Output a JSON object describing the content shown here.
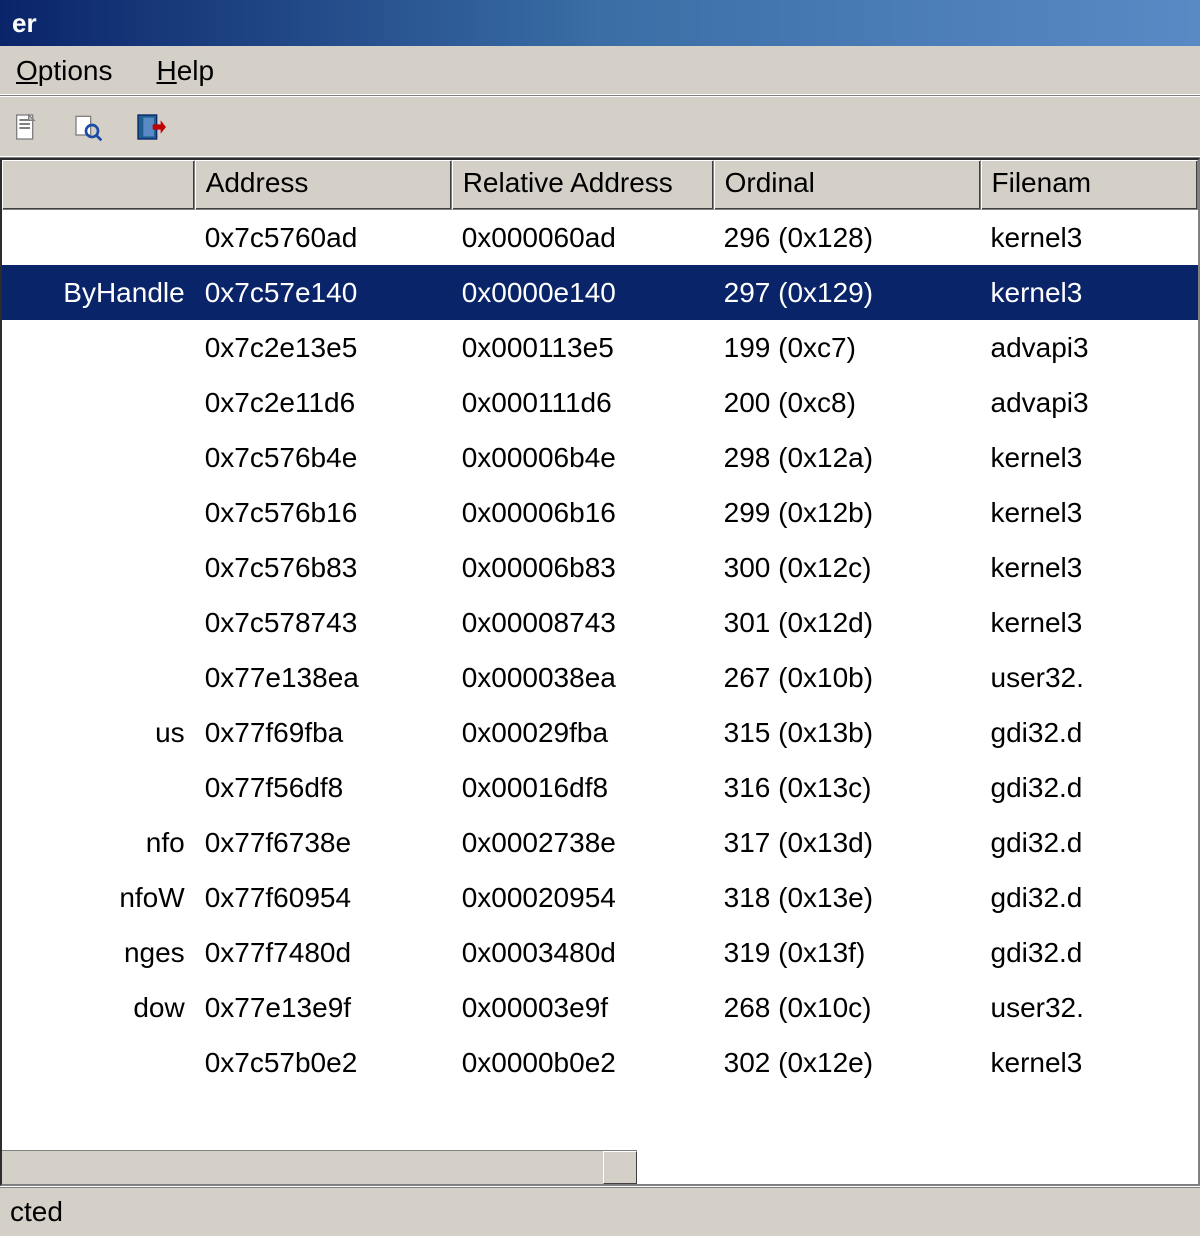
{
  "window": {
    "title": "er"
  },
  "menu": {
    "options": "Options",
    "help": "Help"
  },
  "toolbar": {
    "icons": [
      "document-icon",
      "find-icon",
      "exit-icon"
    ]
  },
  "columns": [
    "",
    "Address",
    "Relative Address",
    "Ordinal",
    "Filenam"
  ],
  "selected_index": 1,
  "rows": [
    {
      "name": "",
      "address": "0x7c5760ad",
      "rel": "0x000060ad",
      "ordinal": "296 (0x128)",
      "file": "kernel3"
    },
    {
      "name": "ByHandle",
      "address": "0x7c57e140",
      "rel": "0x0000e140",
      "ordinal": "297 (0x129)",
      "file": "kernel3"
    },
    {
      "name": "",
      "address": "0x7c2e13e5",
      "rel": "0x000113e5",
      "ordinal": "199 (0xc7)",
      "file": "advapi3"
    },
    {
      "name": "",
      "address": "0x7c2e11d6",
      "rel": "0x000111d6",
      "ordinal": "200 (0xc8)",
      "file": "advapi3"
    },
    {
      "name": "",
      "address": "0x7c576b4e",
      "rel": "0x00006b4e",
      "ordinal": "298 (0x12a)",
      "file": "kernel3"
    },
    {
      "name": "",
      "address": "0x7c576b16",
      "rel": "0x00006b16",
      "ordinal": "299 (0x12b)",
      "file": "kernel3"
    },
    {
      "name": "",
      "address": "0x7c576b83",
      "rel": "0x00006b83",
      "ordinal": "300 (0x12c)",
      "file": "kernel3"
    },
    {
      "name": "",
      "address": "0x7c578743",
      "rel": "0x00008743",
      "ordinal": "301 (0x12d)",
      "file": "kernel3"
    },
    {
      "name": "",
      "address": "0x77e138ea",
      "rel": "0x000038ea",
      "ordinal": "267 (0x10b)",
      "file": "user32."
    },
    {
      "name": "us",
      "address": "0x77f69fba",
      "rel": "0x00029fba",
      "ordinal": "315 (0x13b)",
      "file": "gdi32.d"
    },
    {
      "name": "",
      "address": "0x77f56df8",
      "rel": "0x00016df8",
      "ordinal": "316 (0x13c)",
      "file": "gdi32.d"
    },
    {
      "name": "nfo",
      "address": "0x77f6738e",
      "rel": "0x0002738e",
      "ordinal": "317 (0x13d)",
      "file": "gdi32.d"
    },
    {
      "name": "nfoW",
      "address": "0x77f60954",
      "rel": "0x00020954",
      "ordinal": "318 (0x13e)",
      "file": "gdi32.d"
    },
    {
      "name": "nges",
      "address": "0x77f7480d",
      "rel": "0x0003480d",
      "ordinal": "319 (0x13f)",
      "file": "gdi32.d"
    },
    {
      "name": "dow",
      "address": "0x77e13e9f",
      "rel": "0x00003e9f",
      "ordinal": "268 (0x10c)",
      "file": "user32."
    },
    {
      "name": "",
      "address": "0x7c57b0e2",
      "rel": "0x0000b0e2",
      "ordinal": "302 (0x12e)",
      "file": "kernel3"
    }
  ],
  "statusbar": {
    "text": "cted"
  }
}
